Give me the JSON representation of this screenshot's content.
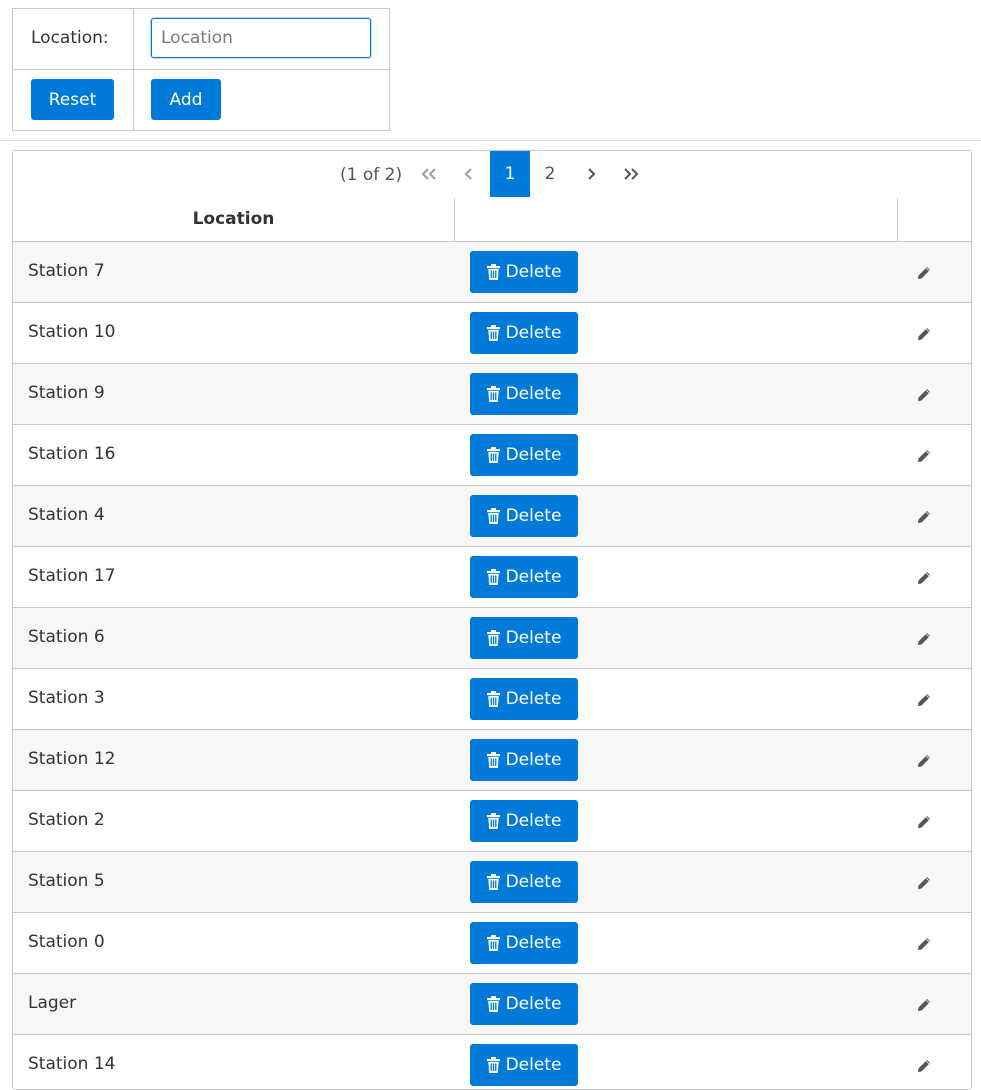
{
  "form": {
    "location_label": "Location:",
    "location_placeholder": "Location",
    "location_value": "",
    "reset_label": "Reset",
    "add_label": "Add"
  },
  "paginator": {
    "current_report": "(1 of 2)",
    "pages": [
      "1",
      "2"
    ],
    "active_page": "1"
  },
  "table": {
    "columns": [
      "Location",
      "",
      ""
    ],
    "delete_label": "Delete",
    "rows": [
      {
        "location": "Station 7"
      },
      {
        "location": "Station 10"
      },
      {
        "location": "Station 9"
      },
      {
        "location": "Station 16"
      },
      {
        "location": "Station 4"
      },
      {
        "location": "Station 17"
      },
      {
        "location": "Station 6"
      },
      {
        "location": "Station 3"
      },
      {
        "location": "Station 12"
      },
      {
        "location": "Station 2"
      },
      {
        "location": "Station 5"
      },
      {
        "location": "Station 0"
      },
      {
        "location": "Lager"
      },
      {
        "location": "Station 14"
      }
    ]
  },
  "colors": {
    "primary": "#007ad9",
    "row_stripe": "#f7f7f7",
    "border": "#c8c8c8"
  },
  "icons": {
    "delete": "trash-icon",
    "edit": "pencil-icon",
    "first": "double-chevron-left-icon",
    "prev": "chevron-left-icon",
    "next": "chevron-right-icon",
    "last": "double-chevron-right-icon"
  }
}
